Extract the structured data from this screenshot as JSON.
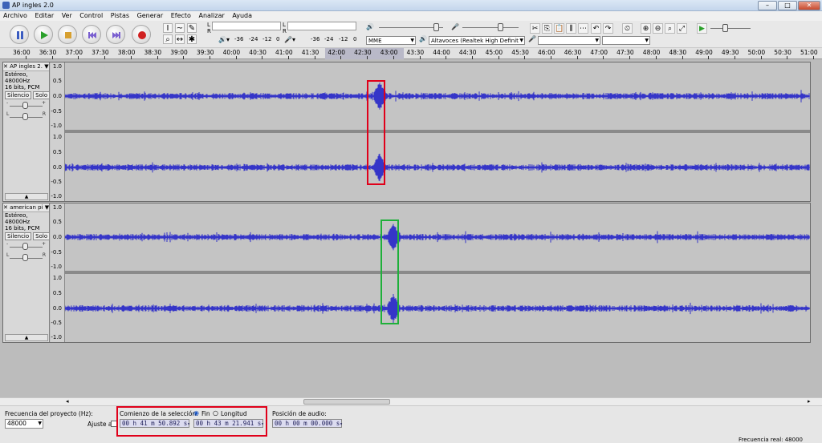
{
  "window": {
    "title": "AP ingles 2.0"
  },
  "menu": [
    "Archivo",
    "Editar",
    "Ver",
    "Control",
    "Pistas",
    "Generar",
    "Efecto",
    "Analizar",
    "Ayuda"
  ],
  "meters": {
    "ticks": [
      "-36",
      "-24",
      "-12",
      "0"
    ]
  },
  "devices": {
    "host": "MME",
    "output": "Altavoces (Realtek High Definit",
    "input": ""
  },
  "timeline": [
    "36:00",
    "36:30",
    "37:00",
    "37:30",
    "38:00",
    "38:30",
    "39:00",
    "39:30",
    "40:00",
    "40:30",
    "41:00",
    "41:30",
    "42:00",
    "42:30",
    "43:00",
    "43:30",
    "44:00",
    "44:30",
    "45:00",
    "45:30",
    "46:00",
    "46:30",
    "47:00",
    "47:30",
    "48:00",
    "48:30",
    "49:00",
    "49:30",
    "50:00",
    "50:30",
    "51:00"
  ],
  "tracks": [
    {
      "name": "AP ingles 2.",
      "info1": "Estéreo, 48000Hz",
      "info2": "16 bits, PCM"
    },
    {
      "name": "american pi",
      "info1": "Estéreo, 48000Hz",
      "info2": "16 bits, PCM"
    }
  ],
  "track_buttons": {
    "mute": "Silencio",
    "solo": "Solo"
  },
  "vruler": [
    "1.0",
    "0.5",
    "0.0",
    "-0.5",
    "-1.0"
  ],
  "bottom": {
    "rate_label": "Frecuencia del proyecto (Hz):",
    "rate_value": "48000",
    "snap_label": "Ajuste a",
    "sel_label": "Comienzo de la selección:",
    "radio_end": "Fin",
    "radio_length": "Longitud",
    "sel_start": "00 h 41 m 50.892 s",
    "sel_end": "00 h 43 m 21.941 s",
    "audio_label": "Posición de audio:",
    "audio_pos": "00 h 00 m 00.000 s",
    "actual_rate": "Frecuencia real: 48000"
  },
  "colors": {
    "waveform": "#3535c8",
    "selection": "#b9b9c8",
    "highlight_red": "#e0001a",
    "highlight_green": "#1fb03a"
  }
}
